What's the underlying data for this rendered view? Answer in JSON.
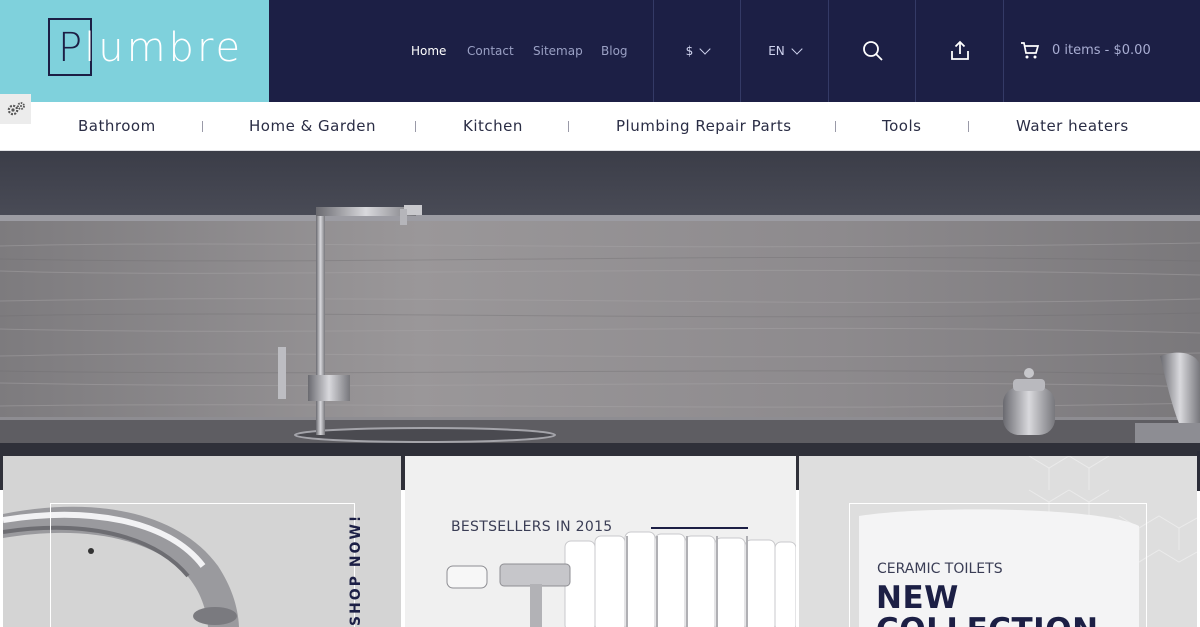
{
  "brand": {
    "logo_letter": "P",
    "logo_rest": "lumbre",
    "colors": {
      "header_bg": "#1c1f45",
      "logo_bg": "#7fd1dc",
      "accent_dark": "#1c1f45"
    }
  },
  "header": {
    "nav": [
      {
        "label": "Home",
        "active": true
      },
      {
        "label": "Contact",
        "active": false
      },
      {
        "label": "Sitemap",
        "active": false
      },
      {
        "label": "Blog",
        "active": false
      }
    ],
    "currency": "$",
    "language": "EN",
    "search_icon": "search-icon",
    "share_icon": "share-upload-icon",
    "cart": {
      "icon": "cart-icon",
      "summary": "0 items - $0.00"
    }
  },
  "settings_tab": {
    "icon": "gears-icon"
  },
  "categories": [
    "Bathroom",
    "Home & Garden",
    "Kitchen",
    "Plumbing Repair Parts",
    "Tools",
    "Water heaters"
  ],
  "promos": {
    "tile1": {
      "cta": "SHOP NOW!"
    },
    "tile2": {
      "eyebrow": "BESTSELLERS IN 2015"
    },
    "tile3": {
      "eyebrow": "CERAMIC TOILETS",
      "title_line1": "NEW",
      "title_line2": "COLLECTION"
    }
  }
}
